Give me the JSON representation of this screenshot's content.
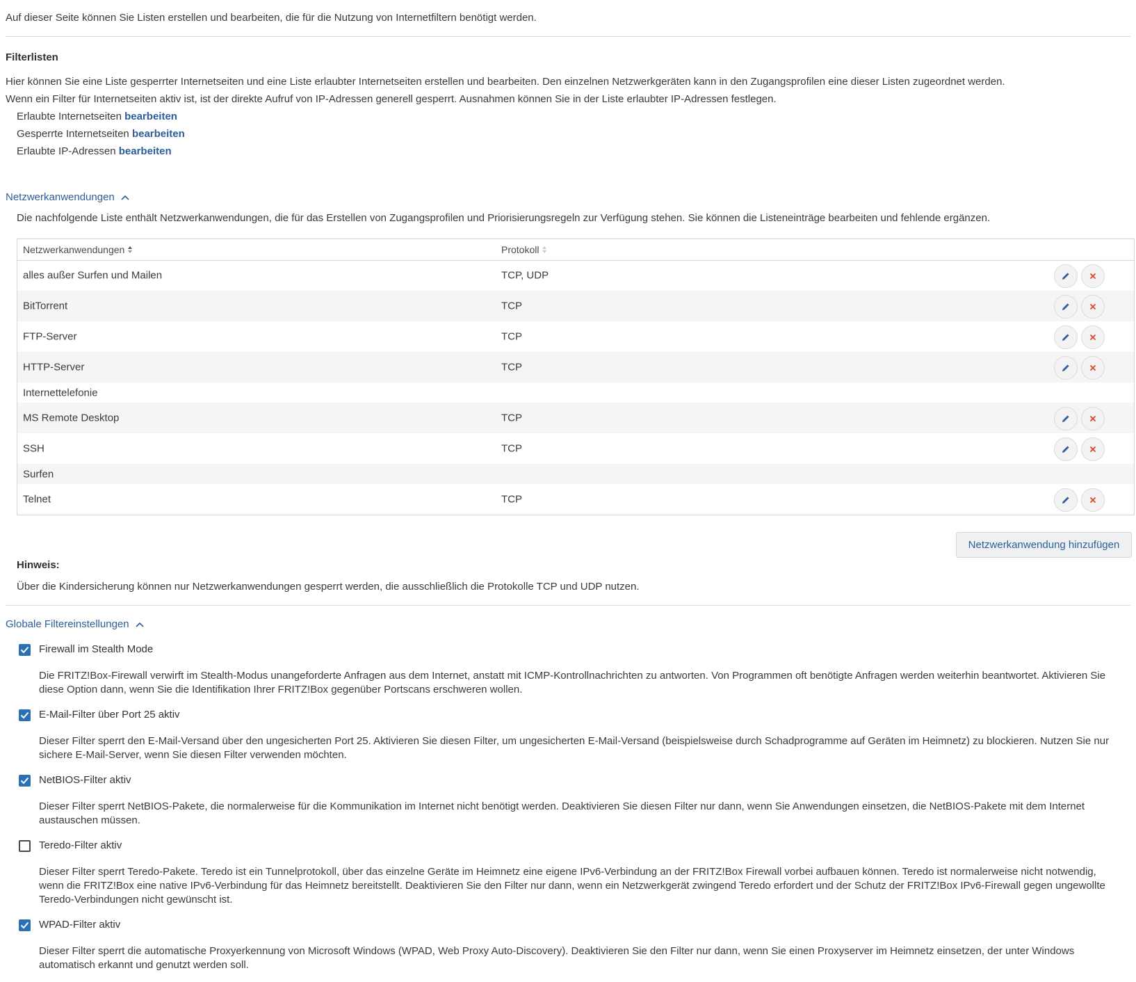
{
  "intro": "Auf dieser Seite können Sie Listen erstellen und bearbeiten, die für die Nutzung von Internetfiltern benötigt werden.",
  "filterlisten": {
    "title": "Filterlisten",
    "line1": "Hier können Sie eine Liste gesperrter Internetseiten und eine Liste erlaubter Internetseiten erstellen und bearbeiten. Den einzelnen Netzwerkgeräten kann in den Zugangsprofilen eine dieser Listen zugeordnet werden.",
    "line2": "Wenn ein Filter für Internetseiten aktiv ist, ist der direkte Aufruf von IP-Adressen generell gesperrt. Ausnahmen können Sie in der Liste erlaubter IP-Adressen festlegen.",
    "items": [
      {
        "label": "Erlaubte Internetseiten",
        "link": "bearbeiten"
      },
      {
        "label": "Gesperrte Internetseiten",
        "link": "bearbeiten"
      },
      {
        "label": "Erlaubte IP-Adressen",
        "link": "bearbeiten"
      }
    ]
  },
  "netzwerk": {
    "heading": "Netzwerkanwendungen",
    "description": "Die nachfolgende Liste enthält Netzwerkanwendungen, die für das Erstellen von Zugangsprofilen und Priorisierungsregeln zur Verfügung stehen. Sie können die Listeneinträge bearbeiten und fehlende ergänzen.",
    "columns": [
      "Netzwerkanwendungen",
      "Protokoll"
    ],
    "rows": [
      {
        "name": "alles außer Surfen und Mailen",
        "protocol": "TCP, UDP",
        "actions": true
      },
      {
        "name": "BitTorrent",
        "protocol": "TCP",
        "actions": true
      },
      {
        "name": "FTP-Server",
        "protocol": "TCP",
        "actions": true
      },
      {
        "name": "HTTP-Server",
        "protocol": "TCP",
        "actions": true
      },
      {
        "name": "Internettelefonie",
        "protocol": "",
        "actions": false
      },
      {
        "name": "MS Remote Desktop",
        "protocol": "TCP",
        "actions": true
      },
      {
        "name": "SSH",
        "protocol": "TCP",
        "actions": true
      },
      {
        "name": "Surfen",
        "protocol": "",
        "actions": false
      },
      {
        "name": "Telnet",
        "protocol": "TCP",
        "actions": true
      }
    ],
    "add_button": "Netzwerkanwendung hinzufügen",
    "hint_title": "Hinweis:",
    "hint_text": "Über die Kindersicherung können nur Netzwerkanwendungen gesperrt werden, die ausschließlich die Protokolle TCP und UDP nutzen."
  },
  "global": {
    "heading": "Globale Filtereinstellungen",
    "options": [
      {
        "label": "Firewall im Stealth Mode",
        "checked": true,
        "desc": "Die FRITZ!Box-Firewall verwirft im Stealth-Modus unangeforderte Anfragen aus dem Internet, anstatt mit ICMP-Kontrollnachrichten zu antworten. Von Programmen oft benötigte Anfragen werden weiterhin beantwortet. Aktivieren Sie diese Option dann, wenn Sie die Identifikation Ihrer FRITZ!Box gegenüber Portscans erschweren wollen."
      },
      {
        "label": "E-Mail-Filter über Port 25 aktiv",
        "checked": true,
        "desc": "Dieser Filter sperrt den E-Mail-Versand über den ungesicherten Port 25. Aktivieren Sie diesen Filter, um ungesicherten E-Mail-Versand (beispielsweise durch Schadprogramme auf Geräten im Heimnetz) zu blockieren. Nutzen Sie nur sichere E-Mail-Server, wenn Sie diesen Filter verwenden möchten."
      },
      {
        "label": "NetBIOS-Filter aktiv",
        "checked": true,
        "desc": "Dieser Filter sperrt NetBIOS-Pakete, die normalerweise für die Kommunikation im Internet nicht benötigt werden. Deaktivieren Sie diesen Filter nur dann, wenn Sie Anwendungen einsetzen, die NetBIOS-Pakete mit dem Internet austauschen müssen."
      },
      {
        "label": "Teredo-Filter aktiv",
        "checked": false,
        "desc": "Dieser Filter sperrt Teredo-Pakete. Teredo ist ein Tunnelprotokoll, über das einzelne Geräte im Heimnetz eine eigene IPv6-Verbindung an der FRITZ!Box Firewall vorbei aufbauen können. Teredo ist normalerweise nicht notwendig, wenn die FRITZ!Box eine native IPv6-Verbindung für das Heimnetz bereitstellt. Deaktivieren Sie den Filter nur dann, wenn ein Netzwerkgerät zwingend Teredo erfordert und der Schutz der FRITZ!Box IPv6-Firewall gegen ungewollte Teredo-Verbindungen nicht gewünscht ist."
      },
      {
        "label": "WPAD-Filter aktiv",
        "checked": true,
        "desc": "Dieser Filter sperrt die automatische Proxyerkennung von Microsoft Windows (WPAD, Web Proxy Auto-Discovery). Deaktivieren Sie den Filter nur dann, wenn Sie einen Proxyserver im Heimnetz einsetzen, der unter Windows automatisch erkannt und genutzt werden soll."
      }
    ]
  },
  "colors": {
    "accent": "#2e5e9a",
    "checkbox": "#2b70b5",
    "delete": "#e0452b",
    "row_alt": "#f5f5f5"
  }
}
